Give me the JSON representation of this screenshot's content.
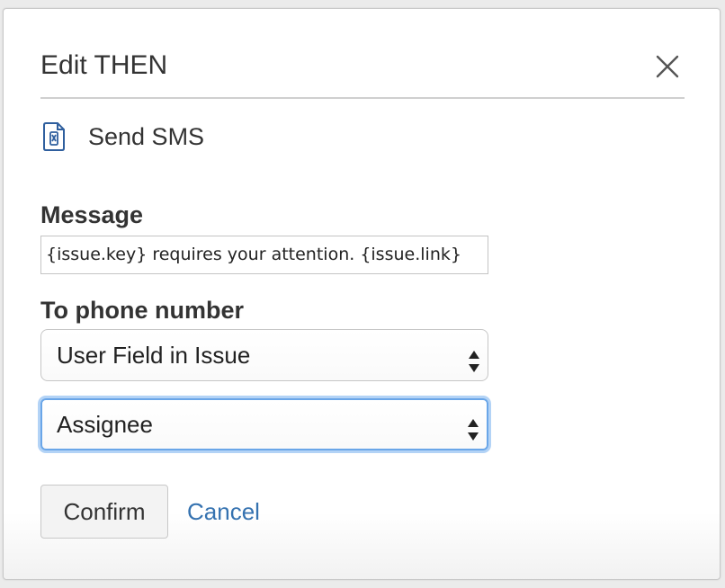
{
  "dialog": {
    "title": "Edit THEN",
    "close_icon": "close-x-icon"
  },
  "action": {
    "icon": "sms-phone-icon",
    "label": "Send SMS"
  },
  "form": {
    "message_label": "Message",
    "message_value": "{issue.key} requires your attention. {issue.link}",
    "phone_label": "To phone number",
    "phone_source_value": "User Field in Issue",
    "phone_field_value": "Assignee"
  },
  "buttons": {
    "confirm_label": "Confirm",
    "cancel_label": "Cancel"
  },
  "colors": {
    "link": "#3572b0",
    "focus_ring": "#6aa6e8",
    "icon_blue": "#2f5f9e"
  }
}
